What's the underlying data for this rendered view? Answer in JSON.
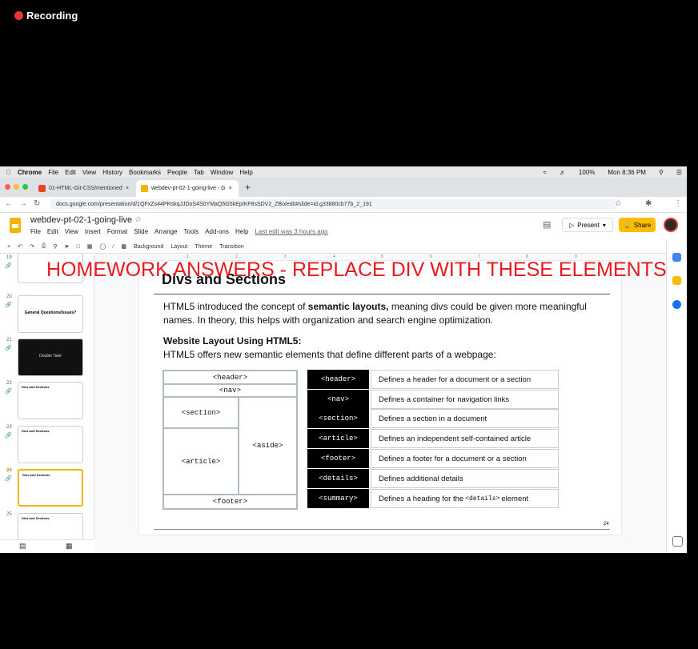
{
  "recording": {
    "label": "Recording"
  },
  "overlay_text": "HOMEWORK ANSWERS - REPLACE DIV WITH THESE ELEMENTS",
  "mac_menu": {
    "app": "Chrome",
    "items": [
      "File",
      "Edit",
      "View",
      "History",
      "Bookmarks",
      "People",
      "Tab",
      "Window",
      "Help"
    ],
    "battery": "100%",
    "clock": "Mon 8:36 PM"
  },
  "tabs": [
    {
      "label": "01-HTML-Git-CSS/mentioned",
      "color": "#e24329"
    },
    {
      "label": "webdev-pt-02-1-going-live - G",
      "color": "#f4b400"
    }
  ],
  "address": "docs.google.com/presentation/d/1QFxZs44PRskqJJDoS4S0YMaQ5G5kEpIKF8sSDV2_ZBo/edit#slide=id.g33880cb77b_2_191",
  "doc": {
    "title": "webdev-pt-02-1-going-live",
    "menus": [
      "File",
      "Edit",
      "View",
      "Insert",
      "Format",
      "Slide",
      "Arrange",
      "Tools",
      "Add-ons",
      "Help"
    ],
    "last_edit": "Last edit was 3 hours ago",
    "present_label": "Present",
    "share_label": "Share"
  },
  "toolbar": {
    "background": "Background",
    "layout": "Layout",
    "theme": "Theme",
    "transition": "Transition"
  },
  "ruler_ticks": [
    "1",
    "2",
    "3",
    "4",
    "5",
    "6",
    "7",
    "8",
    "9"
  ],
  "thumbnails": [
    {
      "num": "19",
      "text": "",
      "dark": false
    },
    {
      "num": "20",
      "text": "General Questions/Issues?",
      "dark": false
    },
    {
      "num": "21",
      "text": "Double Take",
      "dark": true
    },
    {
      "num": "22",
      "text": "Divs and Sections",
      "dark": false
    },
    {
      "num": "23",
      "text": "Divs and Sections",
      "dark": false
    },
    {
      "num": "24",
      "text": "Divs and Sections",
      "dark": false,
      "selected": true
    },
    {
      "num": "25",
      "text": "Divs and Sections",
      "dark": false
    }
  ],
  "slide": {
    "title": "Divs and Sections",
    "para_before": "HTML5 introduced the concept of ",
    "para_bold": "semantic layouts,",
    "para_after": " meaning divs could be given more meaningful names. In theory, this helps with organization and search engine optimization.",
    "subheading": "Website Layout Using HTML5:",
    "subtext": "HTML5 offers new semantic elements that define different parts of a webpage:",
    "diagram": {
      "header": "<header>",
      "nav": "<nav>",
      "section": "<section>",
      "article": "<article>",
      "aside": "<aside>",
      "footer": "<footer>"
    },
    "definitions": [
      {
        "tag": "<header>",
        "desc": "Defines a header for a document or a section"
      },
      {
        "tag": "<nav>",
        "desc": "Defines a container for navigation links"
      },
      {
        "tag": "<section>",
        "desc": "Defines a section in a document"
      },
      {
        "tag": "<article>",
        "desc": "Defines an independent self-contained article"
      },
      {
        "tag": "<footer>",
        "desc": "Defines a footer for a document or a section"
      },
      {
        "tag": "<details>",
        "desc": "Defines additional details"
      },
      {
        "tag": "<summary>",
        "desc_before": "Defines a heading for the",
        "desc_code": "<details>",
        "desc_after": "element"
      }
    ],
    "page_number": "24"
  }
}
